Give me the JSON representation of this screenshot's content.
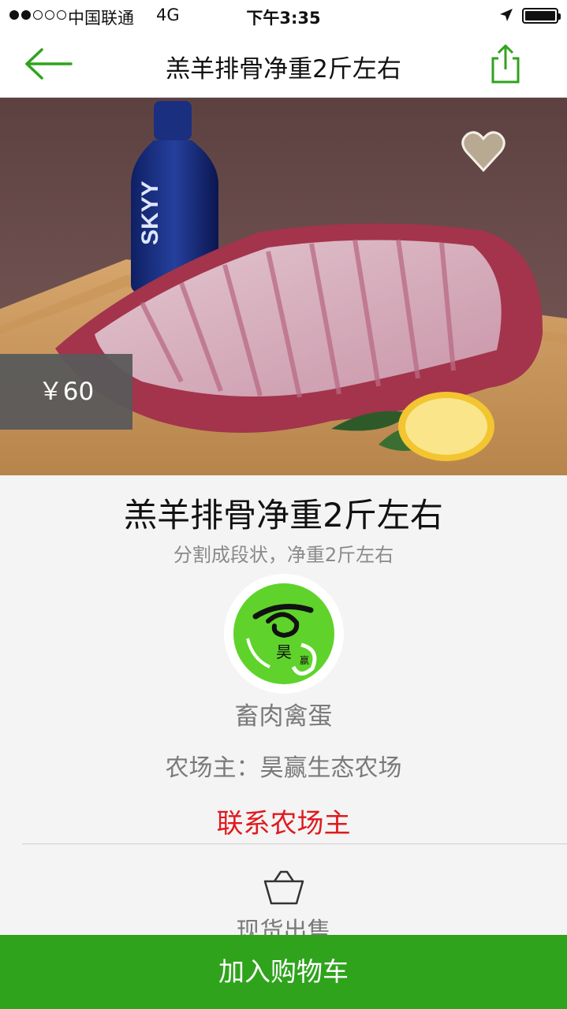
{
  "status_bar": {
    "carrier": "中国联通",
    "network": "4G",
    "time": "下午3:35",
    "signal_bars_filled": 2,
    "signal_bars_total": 5,
    "battery_level": 1.0
  },
  "nav": {
    "title": "羔羊排骨净重2斤左右",
    "back_icon": "arrow-left-icon",
    "share_icon": "share-icon",
    "accent_color": "#2fa31c"
  },
  "hero": {
    "price": "￥60",
    "favorite_icon": "heart-icon",
    "bottle_label": "SKYY"
  },
  "product": {
    "title": "羔羊排骨净重2斤左右",
    "subtitle": "分割成段状，净重2斤左右",
    "category": "畜肉禽蛋",
    "owner": "农场主：昊赢生态农场",
    "contact_label": "联系农场主",
    "contact_color": "#e0191f",
    "logo_text": "昊",
    "logo_text_2": "嬴",
    "stock_label": "现货出售",
    "stock_icon": "basket-icon"
  },
  "actions": {
    "add_to_cart": "加入购物车",
    "button_color": "#2fa31c"
  }
}
